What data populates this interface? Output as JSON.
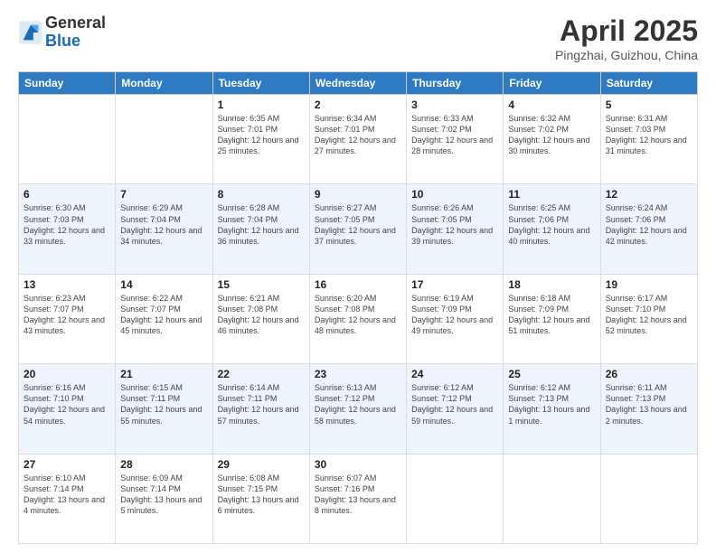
{
  "logo": {
    "general": "General",
    "blue": "Blue"
  },
  "header": {
    "month": "April 2025",
    "location": "Pingzhai, Guizhou, China"
  },
  "weekdays": [
    "Sunday",
    "Monday",
    "Tuesday",
    "Wednesday",
    "Thursday",
    "Friday",
    "Saturday"
  ],
  "weeks": [
    [
      {
        "day": "",
        "info": ""
      },
      {
        "day": "",
        "info": ""
      },
      {
        "day": "1",
        "info": "Sunrise: 6:35 AM\nSunset: 7:01 PM\nDaylight: 12 hours and 25 minutes."
      },
      {
        "day": "2",
        "info": "Sunrise: 6:34 AM\nSunset: 7:01 PM\nDaylight: 12 hours and 27 minutes."
      },
      {
        "day": "3",
        "info": "Sunrise: 6:33 AM\nSunset: 7:02 PM\nDaylight: 12 hours and 28 minutes."
      },
      {
        "day": "4",
        "info": "Sunrise: 6:32 AM\nSunset: 7:02 PM\nDaylight: 12 hours and 30 minutes."
      },
      {
        "day": "5",
        "info": "Sunrise: 6:31 AM\nSunset: 7:03 PM\nDaylight: 12 hours and 31 minutes."
      }
    ],
    [
      {
        "day": "6",
        "info": "Sunrise: 6:30 AM\nSunset: 7:03 PM\nDaylight: 12 hours and 33 minutes."
      },
      {
        "day": "7",
        "info": "Sunrise: 6:29 AM\nSunset: 7:04 PM\nDaylight: 12 hours and 34 minutes."
      },
      {
        "day": "8",
        "info": "Sunrise: 6:28 AM\nSunset: 7:04 PM\nDaylight: 12 hours and 36 minutes."
      },
      {
        "day": "9",
        "info": "Sunrise: 6:27 AM\nSunset: 7:05 PM\nDaylight: 12 hours and 37 minutes."
      },
      {
        "day": "10",
        "info": "Sunrise: 6:26 AM\nSunset: 7:05 PM\nDaylight: 12 hours and 39 minutes."
      },
      {
        "day": "11",
        "info": "Sunrise: 6:25 AM\nSunset: 7:06 PM\nDaylight: 12 hours and 40 minutes."
      },
      {
        "day": "12",
        "info": "Sunrise: 6:24 AM\nSunset: 7:06 PM\nDaylight: 12 hours and 42 minutes."
      }
    ],
    [
      {
        "day": "13",
        "info": "Sunrise: 6:23 AM\nSunset: 7:07 PM\nDaylight: 12 hours and 43 minutes."
      },
      {
        "day": "14",
        "info": "Sunrise: 6:22 AM\nSunset: 7:07 PM\nDaylight: 12 hours and 45 minutes."
      },
      {
        "day": "15",
        "info": "Sunrise: 6:21 AM\nSunset: 7:08 PM\nDaylight: 12 hours and 46 minutes."
      },
      {
        "day": "16",
        "info": "Sunrise: 6:20 AM\nSunset: 7:08 PM\nDaylight: 12 hours and 48 minutes."
      },
      {
        "day": "17",
        "info": "Sunrise: 6:19 AM\nSunset: 7:09 PM\nDaylight: 12 hours and 49 minutes."
      },
      {
        "day": "18",
        "info": "Sunrise: 6:18 AM\nSunset: 7:09 PM\nDaylight: 12 hours and 51 minutes."
      },
      {
        "day": "19",
        "info": "Sunrise: 6:17 AM\nSunset: 7:10 PM\nDaylight: 12 hours and 52 minutes."
      }
    ],
    [
      {
        "day": "20",
        "info": "Sunrise: 6:16 AM\nSunset: 7:10 PM\nDaylight: 12 hours and 54 minutes."
      },
      {
        "day": "21",
        "info": "Sunrise: 6:15 AM\nSunset: 7:11 PM\nDaylight: 12 hours and 55 minutes."
      },
      {
        "day": "22",
        "info": "Sunrise: 6:14 AM\nSunset: 7:11 PM\nDaylight: 12 hours and 57 minutes."
      },
      {
        "day": "23",
        "info": "Sunrise: 6:13 AM\nSunset: 7:12 PM\nDaylight: 12 hours and 58 minutes."
      },
      {
        "day": "24",
        "info": "Sunrise: 6:12 AM\nSunset: 7:12 PM\nDaylight: 12 hours and 59 minutes."
      },
      {
        "day": "25",
        "info": "Sunrise: 6:12 AM\nSunset: 7:13 PM\nDaylight: 13 hours and 1 minute."
      },
      {
        "day": "26",
        "info": "Sunrise: 6:11 AM\nSunset: 7:13 PM\nDaylight: 13 hours and 2 minutes."
      }
    ],
    [
      {
        "day": "27",
        "info": "Sunrise: 6:10 AM\nSunset: 7:14 PM\nDaylight: 13 hours and 4 minutes."
      },
      {
        "day": "28",
        "info": "Sunrise: 6:09 AM\nSunset: 7:14 PM\nDaylight: 13 hours and 5 minutes."
      },
      {
        "day": "29",
        "info": "Sunrise: 6:08 AM\nSunset: 7:15 PM\nDaylight: 13 hours and 6 minutes."
      },
      {
        "day": "30",
        "info": "Sunrise: 6:07 AM\nSunset: 7:16 PM\nDaylight: 13 hours and 8 minutes."
      },
      {
        "day": "",
        "info": ""
      },
      {
        "day": "",
        "info": ""
      },
      {
        "day": "",
        "info": ""
      }
    ]
  ]
}
